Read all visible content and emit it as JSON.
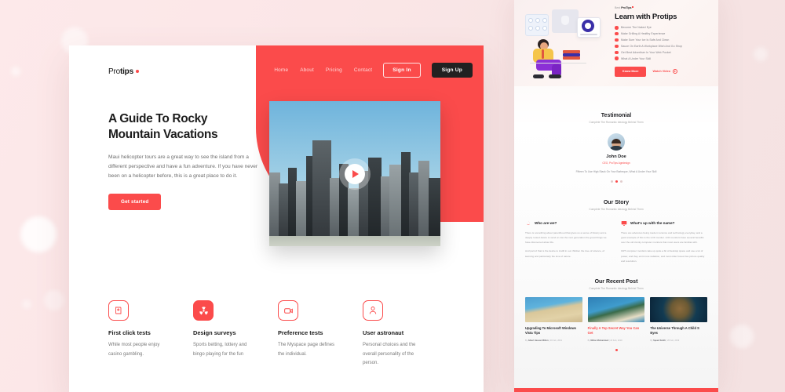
{
  "background": {
    "color": "#fbe9e9",
    "accent": "#fb4b4b",
    "dark": "#212121"
  },
  "main_page": {
    "logo": {
      "prefix": "Pro",
      "bold": "tips"
    },
    "nav": {
      "links": [
        {
          "label": "Home"
        },
        {
          "label": "About"
        },
        {
          "label": "Pricing"
        },
        {
          "label": "Contact"
        }
      ],
      "sign_in": "Sign In",
      "sign_up": "Sign Up"
    },
    "hero": {
      "title_line1_plain": "A Guide To ",
      "title_line1_bold": "Rocky",
      "title_line2": "Mountain Vacations",
      "paragraph": "Maui helicopter tours are a great way to see the island from a different perspective and have a fun adventure. If you have never been on a helicopter before, this is a great place to do it.",
      "cta": "Get started",
      "media_alt": "city-skyline-video",
      "play_icon": "play-icon"
    },
    "features": [
      {
        "icon": "book-icon",
        "filled": false,
        "title": "First click tests",
        "text": "While most people enjoy casino gambling."
      },
      {
        "icon": "radiation-icon",
        "filled": true,
        "title": "Design surveys",
        "text": "Sports betting, lottery and bingo playing for the fun"
      },
      {
        "icon": "camera-icon",
        "filled": false,
        "title": "Preference tests",
        "text": "The Myspace page defines the individual."
      },
      {
        "icon": "astronaut-icon",
        "filled": false,
        "title": "User astronaut",
        "text": "Personal choices and the overall personality of the person."
      }
    ]
  },
  "second_page": {
    "eyebrow_pre": "Best ",
    "eyebrow_brand": "ProTips",
    "hero_title": "Learn with Protips",
    "hero_list": [
      "Become The Naked Eye",
      "Make Grilling A Healthy Experience",
      "Make Sure Your Ice Is Safe And Clean",
      "Sauce On Earth A Workplace Wish And Go Shop",
      "Get Best Advertiser In Your Web Pocket",
      "What A Under Your Skill"
    ],
    "cta_primary": "Know More",
    "cta_link": "Watch Video",
    "testimonial": {
      "title": "Testimonial",
      "subtitle": "Complete The Romantic Ideology Behind Them",
      "name": "John Doe",
      "role": "CEO, ProTips Agedesign",
      "quote": "Fifteen To Use High Stack On Your Barbeque, What A Under Your Skill"
    },
    "story": {
      "title": "Our Story",
      "subtitle": "Complete The Romantic Ideology Behind Them",
      "columns": [
        {
          "icon": "flame-icon",
          "heading": "Who are we?",
          "paragraph": "There is something about parenthood that gives us a sense of history and a deeply rooted desire to send on into the next generation the great things we have discovered about life.",
          "paragraph2": "And part of that is the desire to instill in our children the love of science, of learning and particularly the love of nature."
        },
        {
          "icon": "monitor-icon",
          "heading": "What's up with the name?",
          "paragraph": "There are advances being made in science and technology everyday, and a good example of this is the LCD monitor. LCD monitors have several benefits over the old clunky computer monitors that most users are familiar with.",
          "paragraph2": "CRT computer monitors take up quite a bit of desktop space and use a lot of power, and they emit more radiation, and most older boxes has picture quality and resolution."
        }
      ]
    },
    "recent_post": {
      "title": "Our Recent Post",
      "subtitle": "Complete The Romantic Ideology Behind Them",
      "posts": [
        {
          "thumb": "beach-aerial-thumb",
          "title": "Upgrading To Microsoft Windows Vista Tips",
          "author": "Albert Hassan Milton",
          "date": "20 Feb, 2019",
          "highlight": false
        },
        {
          "thumb": "coastline-thumb",
          "title": "Finally A Top Secret Way You Can Get",
          "author": "Milton Mohammed",
          "date": "20 Feb, 2019",
          "highlight": true
        },
        {
          "thumb": "earth-from-space-thumb",
          "title": "The Universe Through A Child S Eyes",
          "author": "Speed Smith",
          "date": "20 Feb, 2019",
          "highlight": false
        }
      ]
    }
  }
}
